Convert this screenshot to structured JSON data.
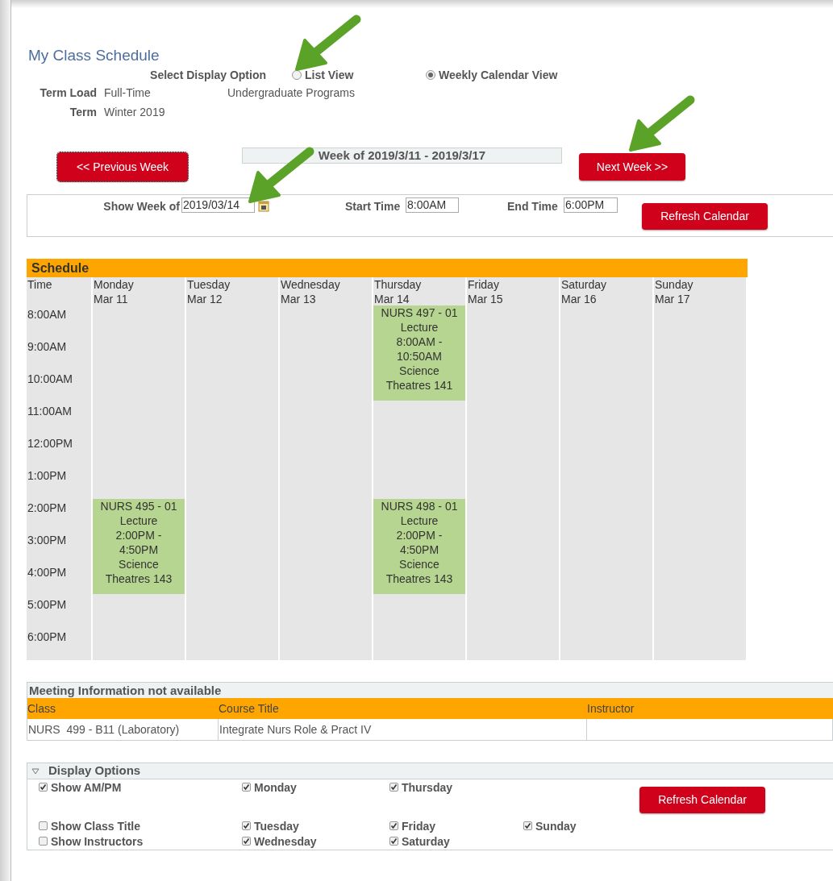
{
  "title": "My Class Schedule",
  "display_option": {
    "label": "Select Display Option",
    "options": [
      {
        "label": "List View",
        "selected": false
      },
      {
        "label": "Weekly Calendar View",
        "selected": true
      }
    ]
  },
  "term_info": [
    {
      "label": "Term Load",
      "value": "Full-Time",
      "extra": "Undergraduate Programs"
    },
    {
      "label": "Term",
      "value": "Winter 2019"
    }
  ],
  "week_nav": {
    "previous": "<< Previous Week",
    "week_label": "Week of 2019/3/11 - 2019/3/17",
    "next": "Next Week >>"
  },
  "filters": {
    "show_week_label": "Show Week of",
    "show_week_value": "2019/03/14",
    "start_label": "Start Time",
    "start_value": "8:00AM",
    "end_label": "End Time",
    "end_value": "6:00PM",
    "refresh": "Refresh Calendar"
  },
  "schedule": {
    "title": "Schedule",
    "time_header": "Time",
    "times": [
      "8:00AM",
      "9:00AM",
      "10:00AM",
      "11:00AM",
      "12:00PM",
      "1:00PM",
      "2:00PM",
      "3:00PM",
      "4:00PM",
      "5:00PM",
      "6:00PM"
    ],
    "days": [
      {
        "name": "Monday",
        "date": "Mar 11",
        "blocks": [
          {
            "kind": "empty"
          },
          {
            "kind": "empty"
          },
          {
            "kind": "empty"
          },
          {
            "kind": "empty"
          },
          {
            "kind": "empty"
          },
          {
            "kind": "empty"
          },
          {
            "kind": "class",
            "lines": [
              "NURS 495 - 01",
              "Lecture",
              "2:00PM -",
              "4:50PM",
              "Science",
              "Theatres 143"
            ]
          }
        ]
      },
      {
        "name": "Tuesday",
        "date": "Mar 12"
      },
      {
        "name": "Wednesday",
        "date": "Mar 13"
      },
      {
        "name": "Thursday",
        "date": "Mar 14",
        "blocks": [
          {
            "kind": "class",
            "lines": [
              "NURS 497 - 01",
              "Lecture",
              "8:00AM -",
              "10:50AM",
              "Science",
              "Theatres 141"
            ]
          },
          {
            "kind": "empty"
          },
          {
            "kind": "empty"
          },
          {
            "kind": "empty"
          },
          {
            "kind": "class",
            "lines": [
              "NURS 498 - 01",
              "Lecture",
              "2:00PM -",
              "4:50PM",
              "Science",
              "Theatres 143"
            ]
          }
        ]
      },
      {
        "name": "Friday",
        "date": "Mar 15"
      },
      {
        "name": "Saturday",
        "date": "Mar 16"
      },
      {
        "name": "Sunday",
        "date": "Mar 17"
      }
    ]
  },
  "meeting_info": {
    "title": "Meeting Information not available",
    "columns": [
      "Class",
      "Course Title",
      "Instructor"
    ],
    "rows": [
      [
        "NURS  499 - B11 (Laboratory)",
        "Integrate Nurs Role & Pract IV"
      ]
    ]
  },
  "display_options": {
    "title": "Display Options",
    "expanded": true,
    "refresh": "Refresh Calendar",
    "rows": [
      [
        {
          "label": "Show AM/PM",
          "checked": true
        },
        {
          "label": "Monday",
          "checked": true
        },
        {
          "label": "Thursday",
          "checked": true
        }
      ],
      [
        {
          "label": "Show Class Title",
          "checked": false
        },
        {
          "label": "Tuesday",
          "checked": true
        },
        {
          "label": "Friday",
          "checked": true
        },
        {
          "label": "Sunday",
          "checked": true
        }
      ],
      [
        {
          "label": "Show Instructors",
          "checked": false
        },
        {
          "label": "Wednesday",
          "checked": true
        },
        {
          "label": "Saturday",
          "checked": true
        }
      ]
    ]
  }
}
